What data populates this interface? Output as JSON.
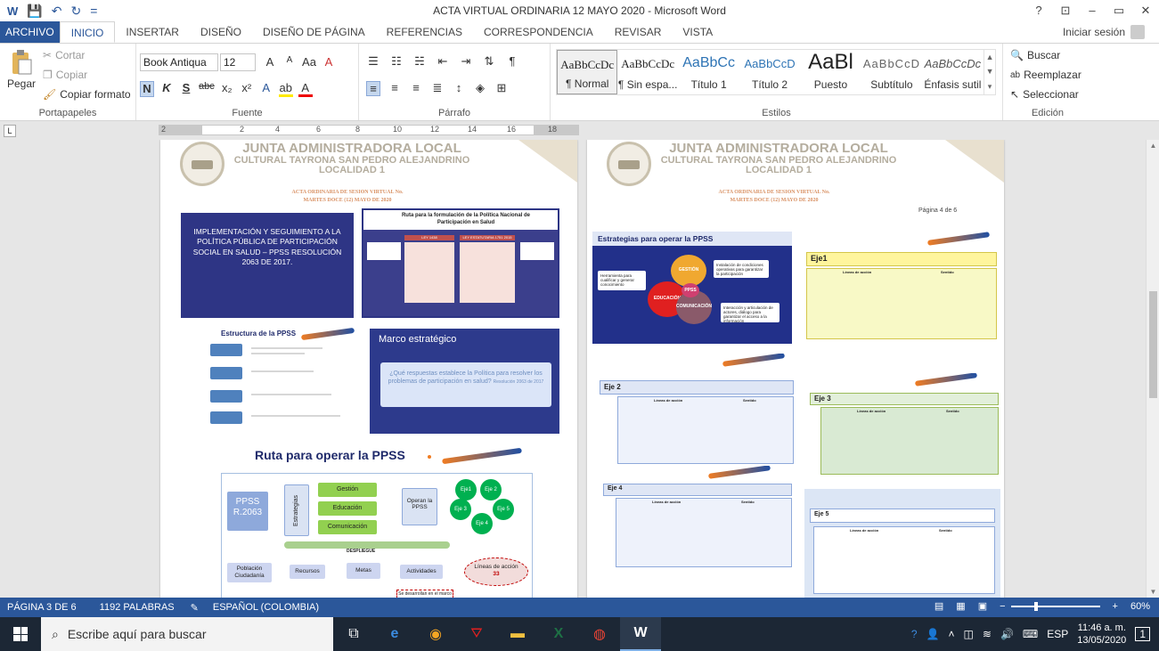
{
  "window": {
    "title": "ACTA VIRTUAL ORDINARIA 12 MAYO 2020 - Microsoft Word",
    "help": "?",
    "min": "–",
    "restore": "▭",
    "close": "✕",
    "ribbon_opts": "⊡"
  },
  "qat": {
    "save": "💾",
    "undo": "↶",
    "redo": "↻",
    "more": "="
  },
  "tabs": [
    {
      "label": "ARCHIVO"
    },
    {
      "label": "INICIO"
    },
    {
      "label": "INSERTAR"
    },
    {
      "label": "DISEÑO"
    },
    {
      "label": "DISEÑO DE PÁGINA"
    },
    {
      "label": "REFERENCIAS"
    },
    {
      "label": "CORRESPONDENCIA"
    },
    {
      "label": "REVISAR"
    },
    {
      "label": "VISTA"
    }
  ],
  "signin": "Iniciar sesión",
  "clipboard": {
    "paste": "Pegar",
    "cut": "Cortar",
    "copy": "Copiar",
    "format_painter": "Copiar formato",
    "label": "Portapapeles"
  },
  "font": {
    "name": "Book Antiqua",
    "size": "12",
    "label": "Fuente",
    "grow": "A",
    "shrink": "A",
    "case": "Aa",
    "clear": "A",
    "bold": "N",
    "italic": "K",
    "underline": "S",
    "strike": "abc",
    "sub": "x₂",
    "sup": "x²",
    "effects": "A",
    "highlight": "ab",
    "color": "A"
  },
  "paragraph": {
    "label": "Párrafo"
  },
  "styles": {
    "label": "Estilos",
    "items": [
      {
        "preview": "AaBbCcDc",
        "name": "¶ Normal"
      },
      {
        "preview": "AaBbCcDc",
        "name": "¶ Sin espa..."
      },
      {
        "preview": "AaBbCc",
        "name": "Título 1"
      },
      {
        "preview": "AaBbCcD",
        "name": "Título 2"
      },
      {
        "preview": "AaBl",
        "name": "Puesto"
      },
      {
        "preview": "AaBbCcD",
        "name": "Subtítulo"
      },
      {
        "preview": "AaBbCcDc",
        "name": "Énfasis sutil"
      }
    ]
  },
  "editing": {
    "label": "Edición",
    "find": "Buscar",
    "replace": "Reemplazar",
    "select": "Seleccionar"
  },
  "ruler": {
    "numbers": [
      "2",
      "2",
      "4",
      "6",
      "8",
      "10",
      "12",
      "14",
      "16",
      "18"
    ]
  },
  "doc": {
    "org_line1": "JUNTA ADMINISTRADORA LOCAL",
    "org_line2": "CULTURAL TAYRONA SAN PEDRO ALEJANDRINO",
    "org_line3": "LOCALIDAD 1",
    "acta_line1": "ACTA ORDINARIA DE SESION VIRTUAL No.",
    "acta_line2": "MARTES DOCE (12) MAYO DE 2020",
    "page4_no": "Página 4 de 6",
    "slide1_title": "IMPLEMENTACIÓN Y SEGUIMIENTO A LA POLÍTICA PÚBLICA DE PARTICIPACIÓN SOCIAL EN SALUD – PPSS RESOLUCIÓN 2063 DE 2017.",
    "slide2_title": "Ruta para la formulación de la Política Nacional de Participación en Salud",
    "slide2_col1": "LEY 1438",
    "slide2_col2": "LEY ESTATUTARIA 1751 2015",
    "slide3_title": "Estructura de la PPSS",
    "slide4_title": "Marco estratégico",
    "slide4_question": "¿Qué respuestas establece la Política para resolver los problemas de participación en salud?",
    "slide4_ref": "Resolución 2063 de 2017",
    "slide5_title": "Ruta para operar la PPSS",
    "ruta": {
      "ppss": "PPSS R.2063",
      "estrategias": "Estrategias",
      "gestion": "Gestión",
      "educacion": "Educación",
      "comunicacion": "Comunicación",
      "operan": "Operan la PPSS",
      "ejes": [
        "Eje1",
        "Eje 2",
        "Eje 3",
        "Eje 5",
        "Eje 4"
      ],
      "despliegue": "DESPLIEGUE",
      "poblacion": "Población Ciudadanía",
      "recursos": "Recursos",
      "metas": "Metas",
      "actividades": "Actividades",
      "lineas": "Líneas de acción",
      "lineas_n": "33",
      "desarrollan": "Se desarrollan en el marco"
    },
    "est_title": "Estrategias para operar la PPSS",
    "est_herr": "Herramienta para cualificar y generar conocimiento",
    "est_inst": "Instalación de condiciones operativas para garantizar la participación",
    "est_info": "Interacción y articulación de actores, diálogo para garantizar el acceso a la información",
    "est_gestion": "GESTIÓN",
    "est_ppss": "PPSS",
    "est_educ": "EDUCACIÓN",
    "est_comun": "COMUNICACIÓN",
    "eje1": "Eje1",
    "eje2": "Eje 2",
    "eje3": "Eje 3",
    "eje4": "Eje 4",
    "eje5": "Eje 5",
    "lineas_accion": "Líneas de acción",
    "sentido": "Sentido"
  },
  "status": {
    "page": "PÁGINA 3 DE 6",
    "words": "1192 PALABRAS",
    "lang": "ESPAÑOL (COLOMBIA)",
    "zoom": "60%",
    "zoom_fraction": 0.6
  },
  "taskbar": {
    "search": "Escribe aquí para buscar",
    "lang": "ESP",
    "time": "11:46 a. m.",
    "date": "13/05/2020",
    "notif": "1"
  }
}
